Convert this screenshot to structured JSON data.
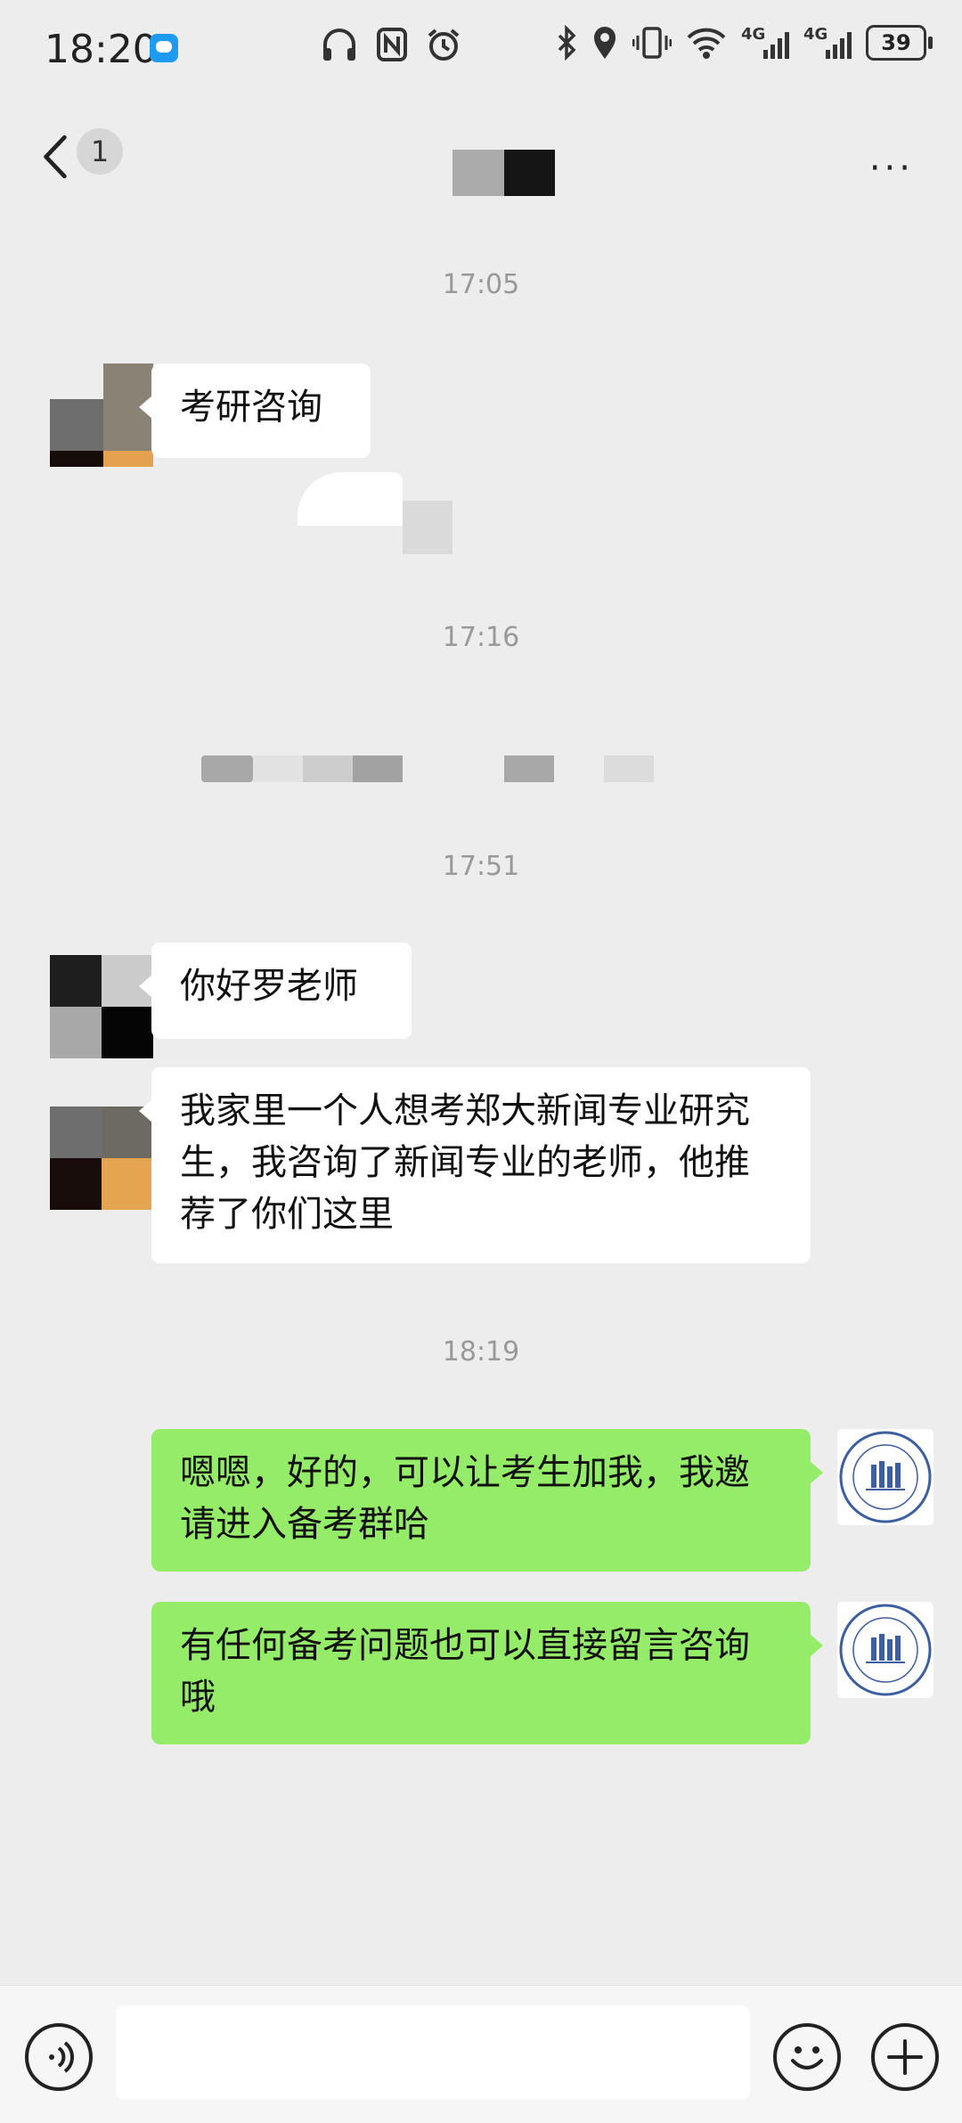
{
  "status_bar": {
    "time": "18:20",
    "signal1": "4G",
    "signal2": "4G",
    "battery": "39"
  },
  "header": {
    "unread_count": "1",
    "more_label": "···"
  },
  "messages": {
    "ts1": "17:05",
    "m1": "考研咨询",
    "ts2": "17:16",
    "ts3": "17:51",
    "m2": "你好罗老师",
    "m3": "我家里一个人想考郑大新闻专业研究生，我咨询了新闻专业的老师，他推荐了你们这里",
    "ts4": "18:19",
    "m4": "嗯嗯，好的，可以让考生加我，我邀请进入备考群哈",
    "m5": "有任何备考问题也可以直接留言咨询哦"
  },
  "input": {
    "placeholder": ""
  },
  "colors": {
    "outgoing_bubble": "#95ec69",
    "incoming_bubble": "#ffffff",
    "background": "#ededed"
  },
  "icons": [
    "voice-icon",
    "emoji-icon",
    "plus-icon",
    "back-icon",
    "more-icon"
  ]
}
